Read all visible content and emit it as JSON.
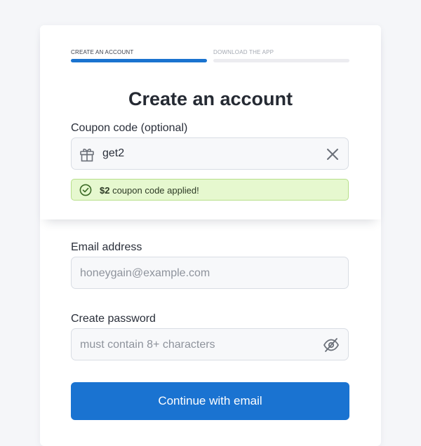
{
  "steps": [
    {
      "label": "CREATE AN ACCOUNT",
      "active": true
    },
    {
      "label": "DOWNLOAD THE APP",
      "active": false
    }
  ],
  "title": "Create an account",
  "coupon": {
    "label": "Coupon code (optional)",
    "value": "get2",
    "success_amount": "$2",
    "success_text": " coupon code applied!"
  },
  "email": {
    "label": "Email address",
    "placeholder": "honeygain@example.com"
  },
  "password": {
    "label": "Create password",
    "placeholder": "must contain 8+ characters"
  },
  "continue_button": "Continue with email",
  "colors": {
    "primary": "#1a73d1",
    "success_bg": "#e6f8cf",
    "success_border": "#b7df8a",
    "success_icon": "#3c6a26"
  },
  "icons": {
    "coupon": "gift-icon",
    "clear": "close-icon",
    "success": "check-circle-icon",
    "password_toggle": "eye-off-icon"
  }
}
